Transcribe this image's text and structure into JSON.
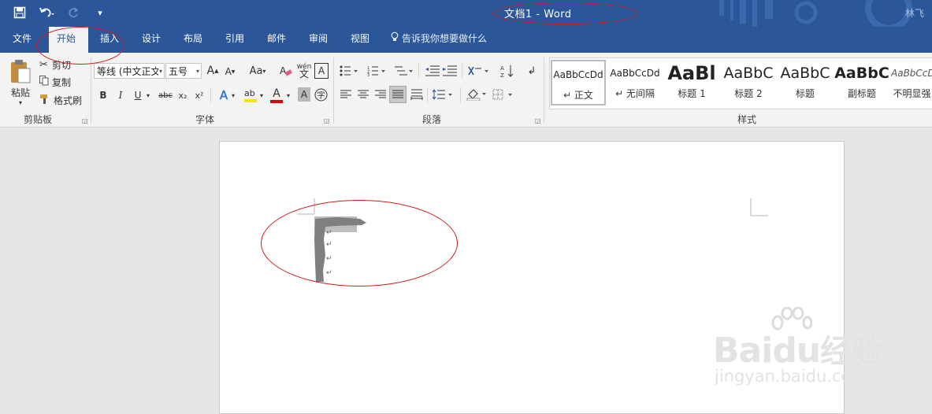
{
  "window": {
    "title": "文档1  -  Word",
    "account": "林飞"
  },
  "qat": {
    "save_icon": "save-icon",
    "undo_icon": "undo-icon",
    "redo_icon": "redo-icon",
    "customize_icon": "customize-qat-icon"
  },
  "tabs": [
    {
      "label": "文件"
    },
    {
      "label": "开始",
      "active": true
    },
    {
      "label": "插入"
    },
    {
      "label": "设计"
    },
    {
      "label": "布局"
    },
    {
      "label": "引用"
    },
    {
      "label": "邮件"
    },
    {
      "label": "审阅"
    },
    {
      "label": "视图"
    }
  ],
  "tellme": "告诉我你想要做什么",
  "clipboard": {
    "paste": "粘贴",
    "cut": "剪切",
    "copy": "复制",
    "format_painter": "格式刷",
    "group": "剪贴板"
  },
  "font": {
    "name": "等线 (中文正文",
    "size": "五号",
    "change_case": "Aa",
    "group": "字体",
    "bold": "B",
    "italic": "I",
    "underline": "U",
    "strike": "abc",
    "subscript": "x₂",
    "superscript": "x²",
    "phonetic": "wén",
    "text_effect": "A",
    "font_color_label": "A",
    "shading_label": "A"
  },
  "paragraph": {
    "group": "段落"
  },
  "styles": {
    "group": "样式",
    "items": [
      {
        "preview": "AaBbCcDd",
        "name": "↵ 正文"
      },
      {
        "preview": "AaBbCcDd",
        "name": "↵ 无间隔"
      },
      {
        "preview": "AaBl",
        "name": "标题 1"
      },
      {
        "preview": "AaBbC",
        "name": "标题 2"
      },
      {
        "preview": "AaBbC",
        "name": "标题"
      },
      {
        "preview": "AaBbC",
        "name": "副标题"
      },
      {
        "preview": "AaBbCcDd",
        "name": "不明显强"
      }
    ]
  },
  "document": {
    "para_marks": [
      "↵",
      "↵",
      "↵",
      "↵"
    ]
  },
  "watermark": {
    "brand": "Bai",
    "brand2": "du",
    "cn": "经验",
    "url": "jingyan.baidu.com"
  },
  "colors": {
    "accent": "#2b579a",
    "annotation": "#d01c1c",
    "font_color": "#e00000",
    "highlight": "#f5e600"
  }
}
